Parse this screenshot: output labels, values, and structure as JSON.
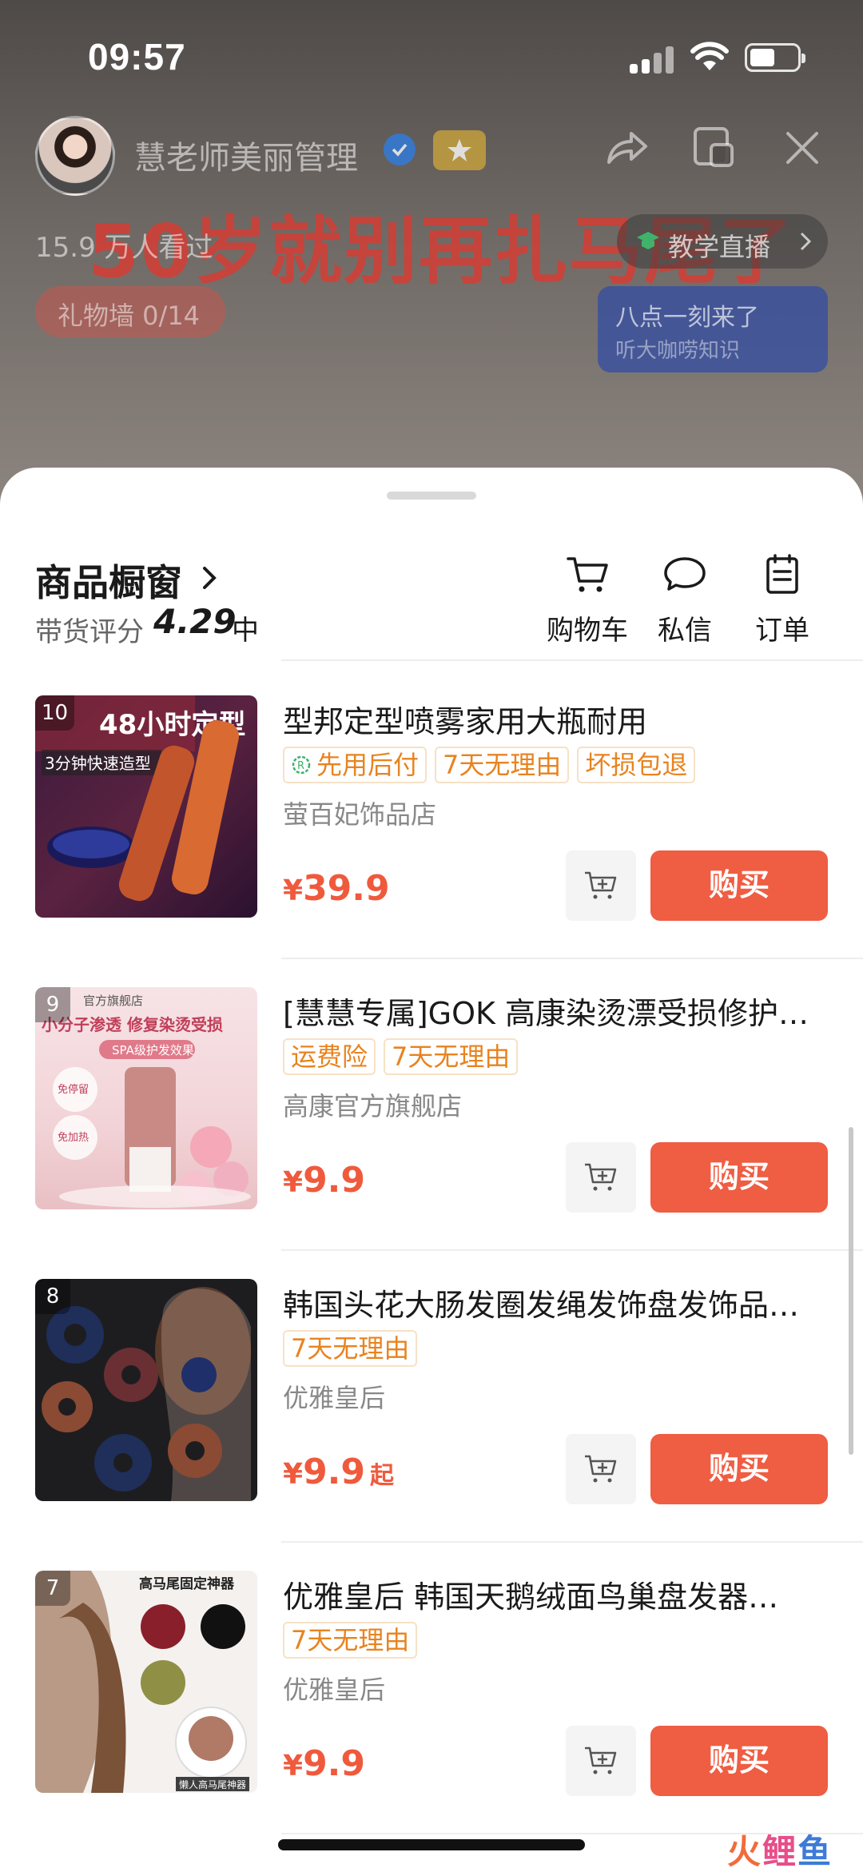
{
  "status_bar": {
    "time": "09:57"
  },
  "stream": {
    "host_name": "慧老师美丽管理",
    "headline": "50岁就别再扎马尾了",
    "viewers": "15.9 万人看过",
    "live_tag": "教学直播",
    "gift_wall": "礼物墙 0/14",
    "promo_line1": "八点一刻来了",
    "promo_line2": "听大咖唠知识"
  },
  "sheet": {
    "title": "商品橱窗",
    "rating_label": "带货评分",
    "rating_value": "4.29",
    "rating_level": "中",
    "actions": [
      {
        "label": "购物车",
        "icon": "cart-icon"
      },
      {
        "label": "私信",
        "icon": "message-icon"
      },
      {
        "label": "订单",
        "icon": "order-icon"
      }
    ]
  },
  "products": [
    {
      "rank": "10",
      "name": "型邦定型喷雾家用大瓶耐用",
      "tags": [
        "先用后付",
        "7天无理由",
        "坏损包退"
      ],
      "store": "萤百妃饰品店",
      "price_symbol": "¥",
      "price": "39.9",
      "price_suffix": "",
      "buy_label": "购买",
      "thumb_text": [
        "48小时定型",
        "3分钟快速造型"
      ]
    },
    {
      "rank": "9",
      "name": "[慧慧专属]GOK 高康染烫漂受损修护…",
      "tags": [
        "运费险",
        "7天无理由"
      ],
      "store": "高康官方旗舰店",
      "price_symbol": "¥",
      "price": "9.9",
      "price_suffix": "",
      "buy_label": "购买",
      "thumb_text": [
        "官方旗舰店",
        "小分子渗透 修复染烫受损",
        "SPA级护发效果",
        "免停留",
        "免加热"
      ]
    },
    {
      "rank": "8",
      "name": "韩国头花大肠发圈发绳发饰盘发饰品…",
      "tags": [
        "7天无理由"
      ],
      "store": "优雅皇后",
      "price_symbol": "¥",
      "price": "9.9",
      "price_suffix": "起",
      "buy_label": "购买",
      "thumb_text": []
    },
    {
      "rank": "7",
      "name": "优雅皇后 韩国天鹅绒面鸟巢盘发器…",
      "tags": [
        "7天无理由"
      ],
      "store": "优雅皇后",
      "price_symbol": "¥",
      "price": "9.9",
      "price_suffix": "",
      "buy_label": "购买",
      "thumb_text": [
        "高马尾固定神器",
        "懒人高马尾神器"
      ]
    }
  ],
  "watermark": [
    "火",
    "鲤",
    "鱼"
  ]
}
